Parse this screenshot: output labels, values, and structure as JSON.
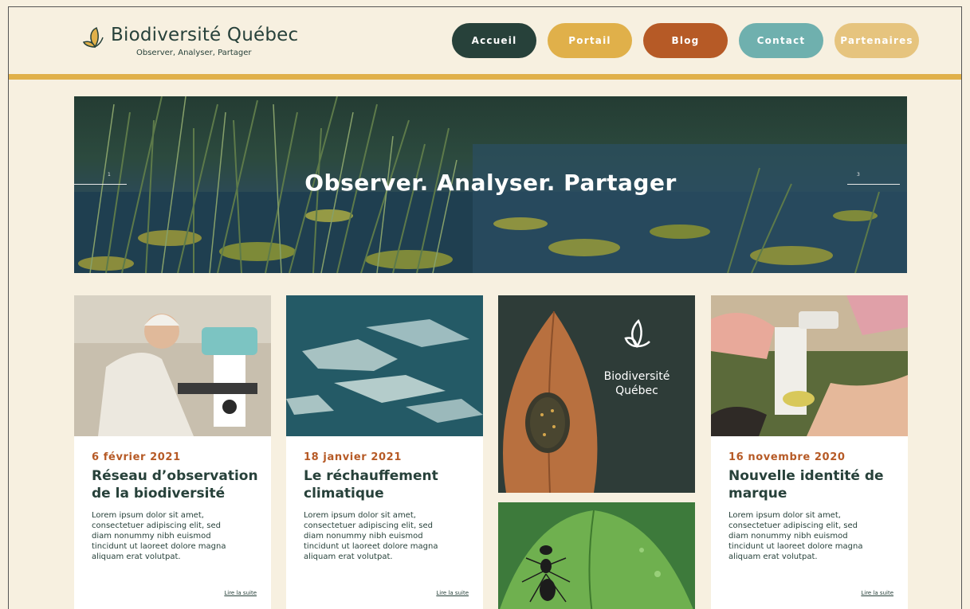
{
  "brand": {
    "name": "Biodiversité Québec",
    "tagline": "Observer, Analyser, Partager"
  },
  "nav": {
    "items": [
      {
        "label": "Accueil",
        "color": "#27413a"
      },
      {
        "label": "Portail",
        "color": "#e0b04a"
      },
      {
        "label": "Blog",
        "color": "#b65a26"
      },
      {
        "label": "Contact",
        "color": "#6fb0ae"
      },
      {
        "label": "Partenaires",
        "color": "#e6c47e"
      }
    ]
  },
  "hero": {
    "title": "Observer. Analyser. Partager",
    "prev_number": "1",
    "next_number": "3"
  },
  "cards": [
    {
      "date": "6 février 2021",
      "title": "Réseau d’observation de la biodiversité",
      "body": "Lorem ipsum dolor sit amet, consectetuer adipiscing elit, sed diam nonummy nibh euismod tincidunt ut laoreet dolore magna aliquam erat volutpat.",
      "link": "Lire la suite",
      "image": "scientist-microscope"
    },
    {
      "date": "18 janvier 2021",
      "title": "Le réchauffement climatique",
      "body": "Lorem ipsum dolor sit amet, consectetuer adipiscing elit, sed diam nonummy nibh euismod tincidunt ut laoreet dolore magna aliquam erat volutpat.",
      "link": "Lire la suite",
      "image": "ice-floes"
    },
    {
      "date": "16 novembre 2020",
      "title": "Nouvelle identité de marque",
      "body": "Lorem ipsum dolor sit amet, consectetuer adipiscing elit, sed diam nonummy nibh euismod tincidunt ut laoreet dolore magna aliquam erat volutpat.",
      "link": "Lire la suite",
      "image": "students-microscope"
    }
  ],
  "feature_tile": {
    "brand_line1": "Biodiversité",
    "brand_line2": "Québec",
    "image": "beetle-on-leaf"
  },
  "second_tile": {
    "image": "ant-on-leaf"
  },
  "colors": {
    "background": "#f7f0e0",
    "dark_green": "#27413a",
    "gold": "#e0b04a",
    "rust": "#b65a26",
    "teal": "#6fb0ae"
  }
}
